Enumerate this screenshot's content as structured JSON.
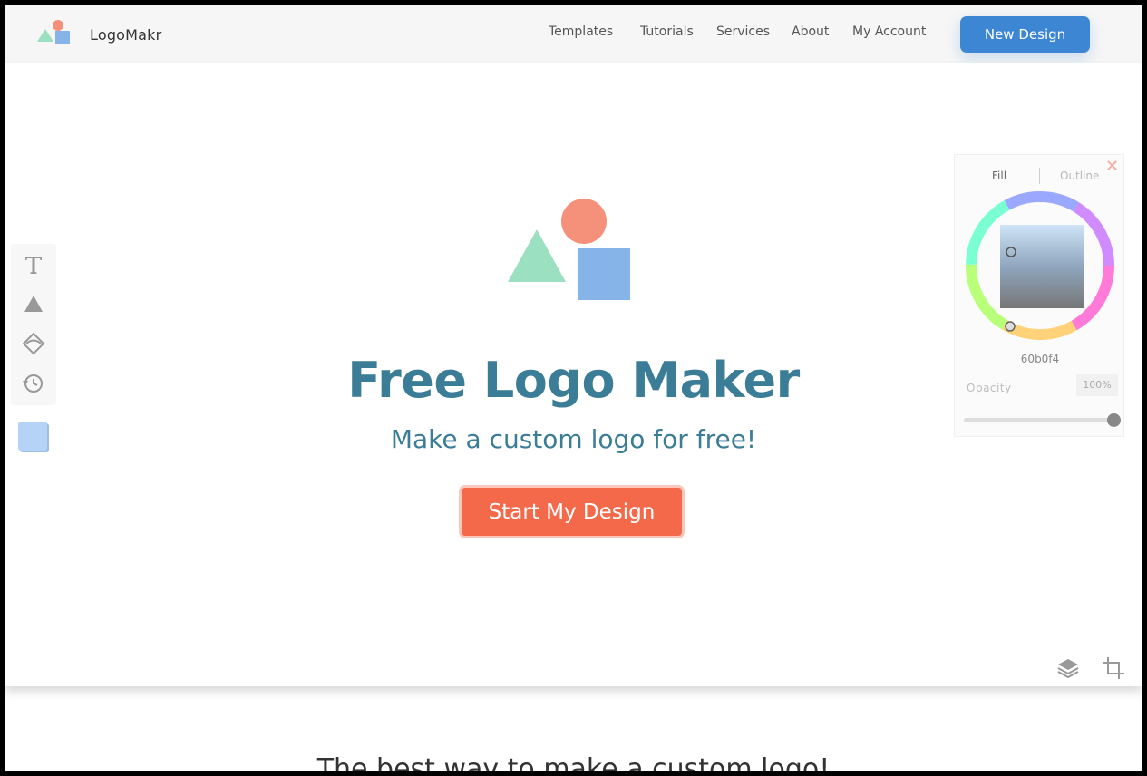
{
  "header": {
    "brand": "LogoMakr",
    "nav": [
      "Templates",
      "Tutorials",
      "Services",
      "About",
      "My Account"
    ],
    "new_design": "New Design"
  },
  "hero": {
    "title": "Free Logo Maker",
    "subtitle": "Make a custom logo for free!",
    "cta": "Start My Design"
  },
  "color_panel": {
    "tab_fill": "Fill",
    "tab_outline": "Outline",
    "hex": "60b0f4",
    "opacity_label": "Opacity",
    "opacity_value": "100%",
    "opacity_level": 1.0
  },
  "icons": {
    "toolbar": [
      "text-icon",
      "shape-icon",
      "clipart-icon",
      "history-icon"
    ],
    "bottom_right": [
      "layers-icon",
      "crop-icon"
    ]
  },
  "colors": {
    "brand_blue": "#3d86d3",
    "cta_orange": "#f4694a",
    "title_teal": "#3b7d97",
    "shape_circle": "#f5907a",
    "shape_triangle": "#9be0c0",
    "shape_square": "#86b3e8",
    "selected_swatch": "#b4d3f7"
  },
  "below_fold": {
    "heading": "The best way to make a custom logo!"
  }
}
